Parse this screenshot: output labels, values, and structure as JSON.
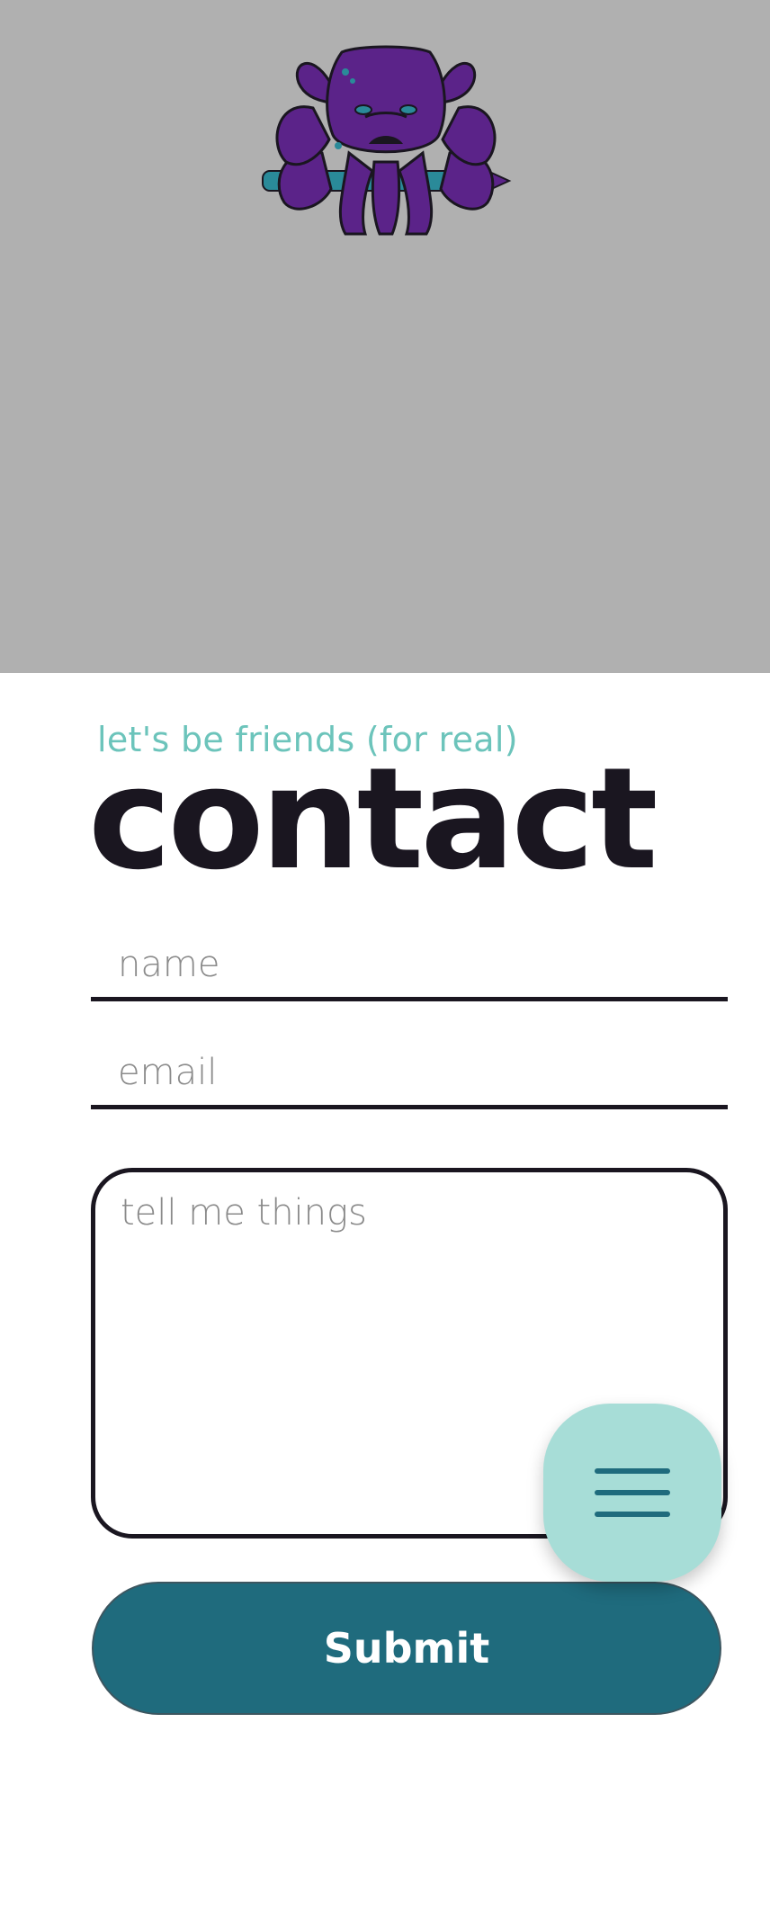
{
  "hero": {
    "logo_icon": "octopus-with-pencil-logo"
  },
  "header": {
    "subtitle": "let's be friends (for real)",
    "title": "contact"
  },
  "form": {
    "name_placeholder": "name",
    "email_placeholder": "email",
    "message_placeholder": "tell me things",
    "submit_label": "Submit"
  },
  "menu": {
    "icon": "hamburger-menu-icon"
  },
  "colors": {
    "hero_background": "#b0b0b0",
    "accent_teal": "#6cc4bb",
    "submit_background": "#1f6b7d",
    "menu_background": "#a7ddd7",
    "text_dark": "#1a1620",
    "octopus_purple": "#5b2389"
  }
}
